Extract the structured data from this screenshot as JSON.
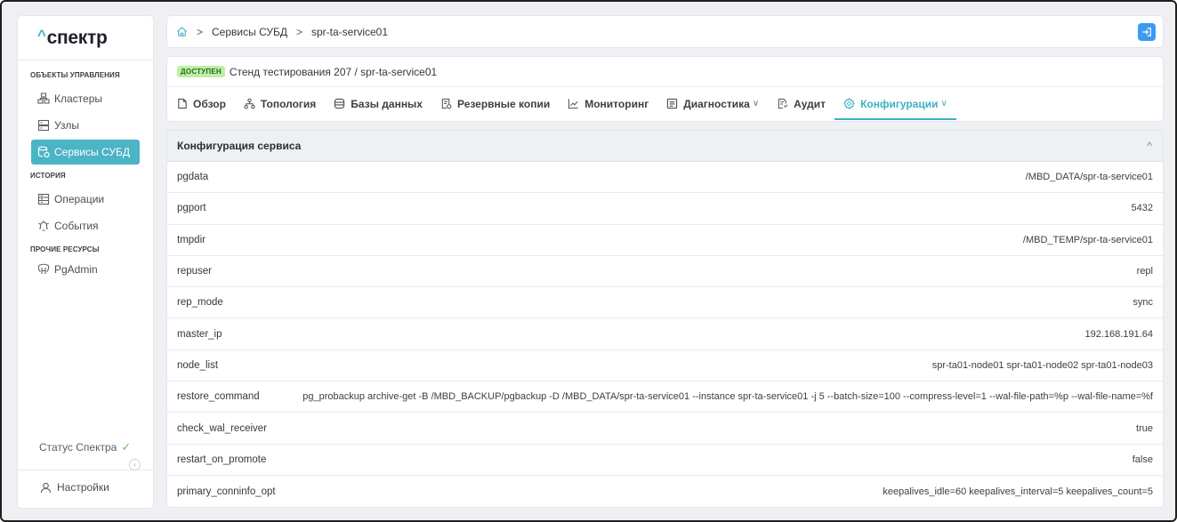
{
  "app": {
    "logo_caret": "^",
    "logo_text": "спектр"
  },
  "sidebar": {
    "sections": [
      {
        "title": "ОБЪЕКТЫ УПРАВЛЕНИЯ"
      },
      {
        "title": "ИСТОРИЯ"
      },
      {
        "title": "ПРОЧИЕ РЕСУРСЫ"
      }
    ],
    "items": [
      {
        "label": "Кластеры",
        "icon": "clusters-icon"
      },
      {
        "label": "Узлы",
        "icon": "nodes-icon"
      },
      {
        "label": "Сервисы СУБД",
        "icon": "db-services-icon",
        "active": true
      },
      {
        "label": "Операции",
        "icon": "operations-icon"
      },
      {
        "label": "События",
        "icon": "events-icon"
      },
      {
        "label": "PgAdmin",
        "icon": "pgadmin-icon"
      }
    ],
    "status_label": "Статус Спектра",
    "settings_label": "Настройки"
  },
  "breadcrumb": {
    "items": [
      "Сервисы СУБД",
      "spr-ta-service01"
    ],
    "separator": ">"
  },
  "service": {
    "status_badge": "ДОСТУПЕН",
    "title": "Стенд тестирования 207 / spr-ta-service01"
  },
  "tabs": [
    {
      "label": "Обзор",
      "icon": "overview-icon"
    },
    {
      "label": "Топология",
      "icon": "topology-icon"
    },
    {
      "label": "Базы данных",
      "icon": "database-icon"
    },
    {
      "label": "Резервные копии",
      "icon": "backup-icon"
    },
    {
      "label": "Мониторинг",
      "icon": "monitoring-icon"
    },
    {
      "label": "Диагностика",
      "icon": "diagnostics-icon",
      "dropdown": true
    },
    {
      "label": "Аудит",
      "icon": "audit-icon"
    },
    {
      "label": "Конфигурации",
      "icon": "gear-icon",
      "dropdown": true,
      "active": true
    }
  ],
  "config": {
    "title": "Конфигурация сервиса",
    "rows": [
      {
        "key": "pgdata",
        "value": "/MBD_DATA/spr-ta-service01"
      },
      {
        "key": "pgport",
        "value": "5432"
      },
      {
        "key": "tmpdir",
        "value": "/MBD_TEMP/spr-ta-service01"
      },
      {
        "key": "repuser",
        "value": "repl"
      },
      {
        "key": "rep_mode",
        "value": "sync"
      },
      {
        "key": "master_ip",
        "value": "192.168.191.64"
      },
      {
        "key": "node_list",
        "value": "spr-ta01-node01 spr-ta01-node02 spr-ta01-node03"
      },
      {
        "key": "restore_command",
        "value": "pg_probackup archive-get -B /MBD_BACKUP/pgbackup -D /MBD_DATA/spr-ta-service01 --instance spr-ta-service01 -j 5 --batch-size=100 --compress-level=1 --wal-file-path=%p --wal-file-name=%f"
      },
      {
        "key": "check_wal_receiver",
        "value": "true"
      },
      {
        "key": "restart_on_promote",
        "value": "false"
      },
      {
        "key": "primary_conninfo_opt",
        "value": "keepalives_idle=60 keepalives_interval=5 keepalives_count=5"
      }
    ]
  },
  "colors": {
    "accent": "#3fb0c4",
    "badge_bg": "#bdf0a6",
    "exit_button": "#3d9bf0"
  }
}
